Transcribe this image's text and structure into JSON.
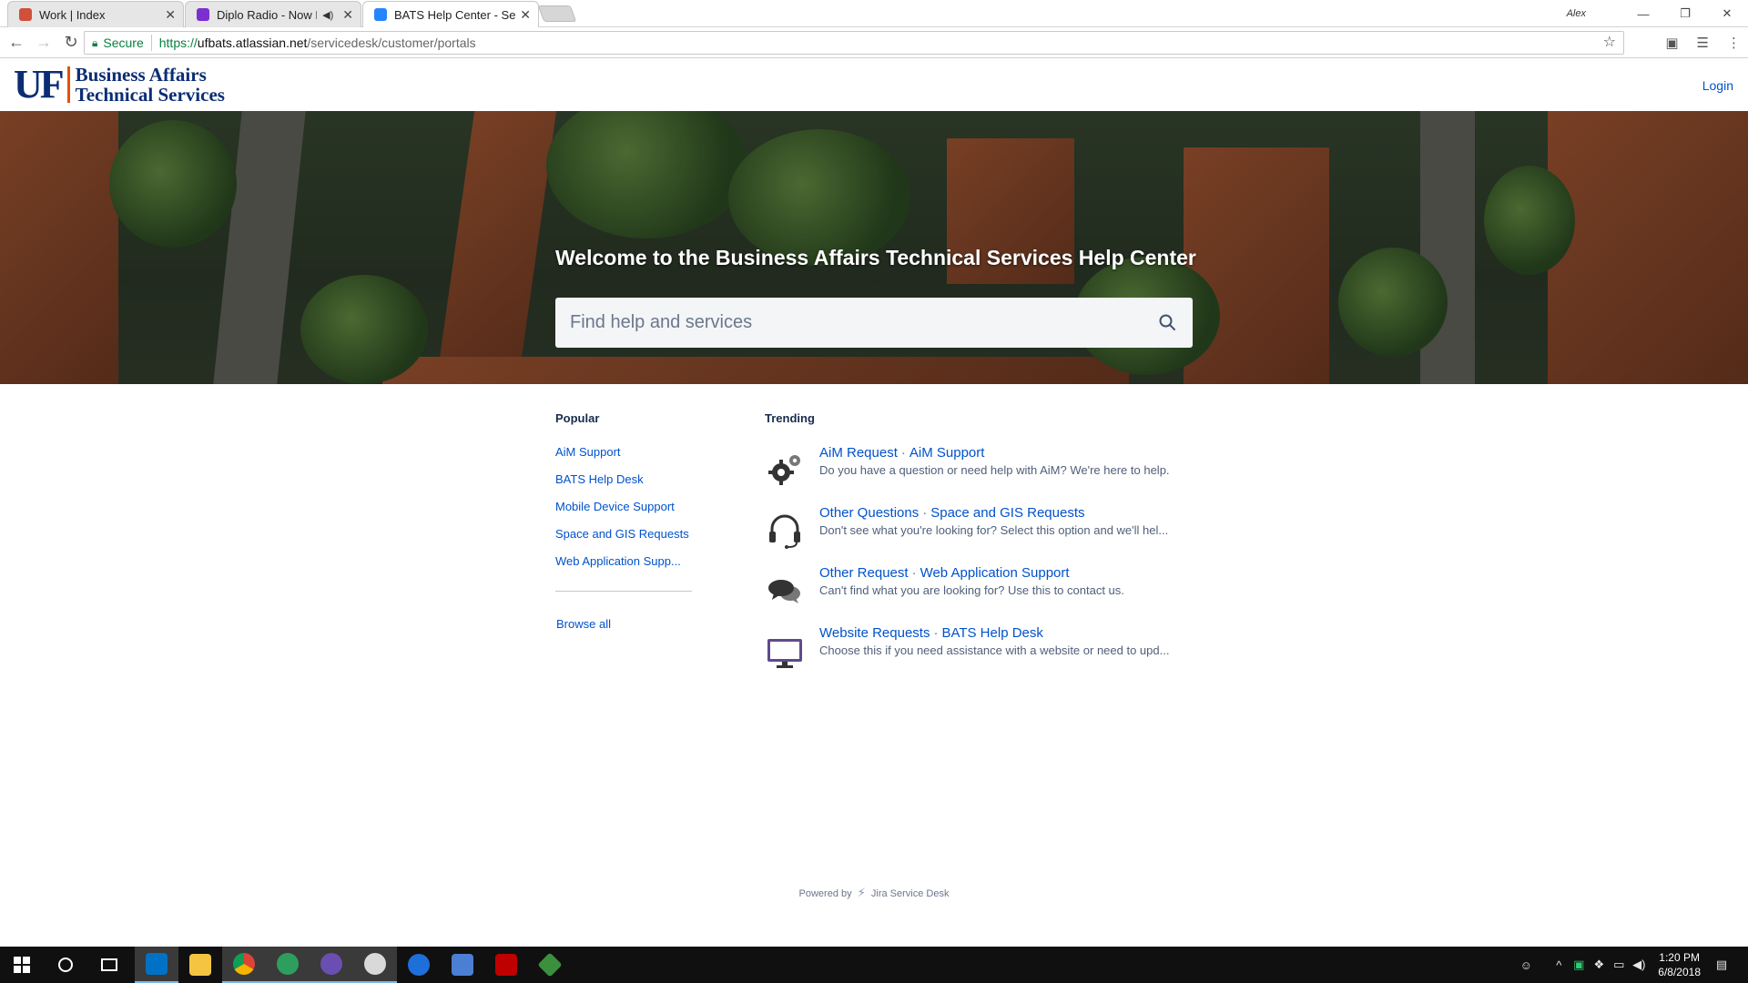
{
  "browser": {
    "tabs": [
      {
        "title": "Work | Index",
        "favicon_color": "#d0503c"
      },
      {
        "title": "Diplo Radio - Now Pla",
        "favicon_color": "#7b2fd0"
      },
      {
        "title": "BATS Help Center - Servic",
        "favicon_color": "#2684ff"
      }
    ],
    "user_name": "Alex",
    "secure_label": "Secure",
    "url_scheme": "https://",
    "url_host": "ufbats.atlassian.net",
    "url_path": "/servicedesk/customer/portals"
  },
  "header": {
    "logo_letters": "UF",
    "logo_line1": "Business Affairs",
    "logo_line2": "Technical Services",
    "login_label": "Login"
  },
  "hero": {
    "title": "Welcome to the Business Affairs Technical Services Help Center",
    "search_placeholder": "Find help and services"
  },
  "popular": {
    "heading": "Popular",
    "links": [
      "AiM Support",
      "BATS Help Desk",
      "Mobile Device Support",
      "Space and GIS Requests",
      "Web Application Supp..."
    ],
    "browse_all": "Browse all"
  },
  "trending": {
    "heading": "Trending",
    "items": [
      {
        "request": "AiM Request",
        "portal": "AiM Support",
        "description": "Do you have a question or need help with AiM? We're here to help.",
        "icon": "gears-icon"
      },
      {
        "request": "Other Questions",
        "portal": "Space and GIS Requests",
        "description": "Don't see what you're looking for? Select this option and we'll hel...",
        "icon": "headset-icon"
      },
      {
        "request": "Other Request",
        "portal": "Web Application Support",
        "description": "Can't find what you are looking for? Use this to contact us.",
        "icon": "chat-bubbles-icon"
      },
      {
        "request": "Website Requests",
        "portal": "BATS Help Desk",
        "description": "Choose this if you need assistance with a website or need to upd...",
        "icon": "monitor-icon"
      }
    ]
  },
  "footer": {
    "powered_prefix": "Powered by",
    "powered_product": "Jira Service Desk"
  },
  "taskbar": {
    "time": "1:20 PM",
    "date": "6/8/2018"
  },
  "colors": {
    "link": "#0052cc",
    "uf_blue": "#0b2d74",
    "uf_orange": "#e35205"
  }
}
